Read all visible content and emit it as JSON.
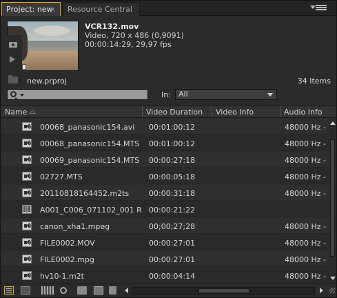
{
  "tabs": {
    "project": "Project: new",
    "resource": "Resource Central",
    "close_glyph": "×"
  },
  "preview": {
    "clip_name": "VCR132.mov",
    "line1": "Video, 720 x 486 (0,9091)",
    "line2": "00:00:14:29, 29,97 fps"
  },
  "project": {
    "name": "new.prproj",
    "items_count": "34 Items"
  },
  "filter": {
    "in_label": "In:",
    "in_value": "All"
  },
  "columns": {
    "name": "Name",
    "video_duration": "Video Duration",
    "video_info": "Video Info",
    "audio_info": "Audio Info"
  },
  "rows": [
    {
      "icon": "audio-video-clip-icon",
      "name": "00068_panasonic154.avi",
      "duration": "00:01:00:12",
      "audio": "48000 Hz -"
    },
    {
      "icon": "audio-video-clip-icon",
      "name": "00068_panasonic154.MTS",
      "duration": "00:01:00:12",
      "audio": "48000 Hz -"
    },
    {
      "icon": "audio-video-clip-icon",
      "name": "00069_panasonic154.MTS",
      "duration": "00:00:27:18",
      "audio": "48000 Hz -"
    },
    {
      "icon": "audio-video-clip-icon",
      "name": "02727.MTS",
      "duration": "00:00:05:18",
      "audio": "48000 Hz -"
    },
    {
      "icon": "audio-video-clip-icon",
      "name": "20110818164452.m2ts",
      "duration": "00:00:31:18",
      "audio": "48000 Hz -"
    },
    {
      "icon": "video-clip-icon",
      "name": "A001_C006_071102_001 R",
      "duration": "00:00:21:22",
      "audio": ""
    },
    {
      "icon": "audio-video-clip-icon",
      "name": "canon_xha1.mpeg",
      "duration": "00;00;27;28",
      "audio": "48000 Hz -"
    },
    {
      "icon": "audio-video-clip-icon",
      "name": "FILE0002.MOV",
      "duration": "00:00:27:01",
      "audio": "48000 Hz -"
    },
    {
      "icon": "audio-video-clip-icon",
      "name": "FILE0002.mpg",
      "duration": "00:00:27:01",
      "audio": "48000 Hz -"
    },
    {
      "icon": "audio-video-clip-icon",
      "name": "hv10-1.m2t",
      "duration": "00:00:04:14",
      "audio": "48000 Hz -"
    }
  ],
  "colors": {
    "accent": "#d9a628",
    "panel_bg": "#2b2b2b",
    "text": "#d6d6d6"
  }
}
